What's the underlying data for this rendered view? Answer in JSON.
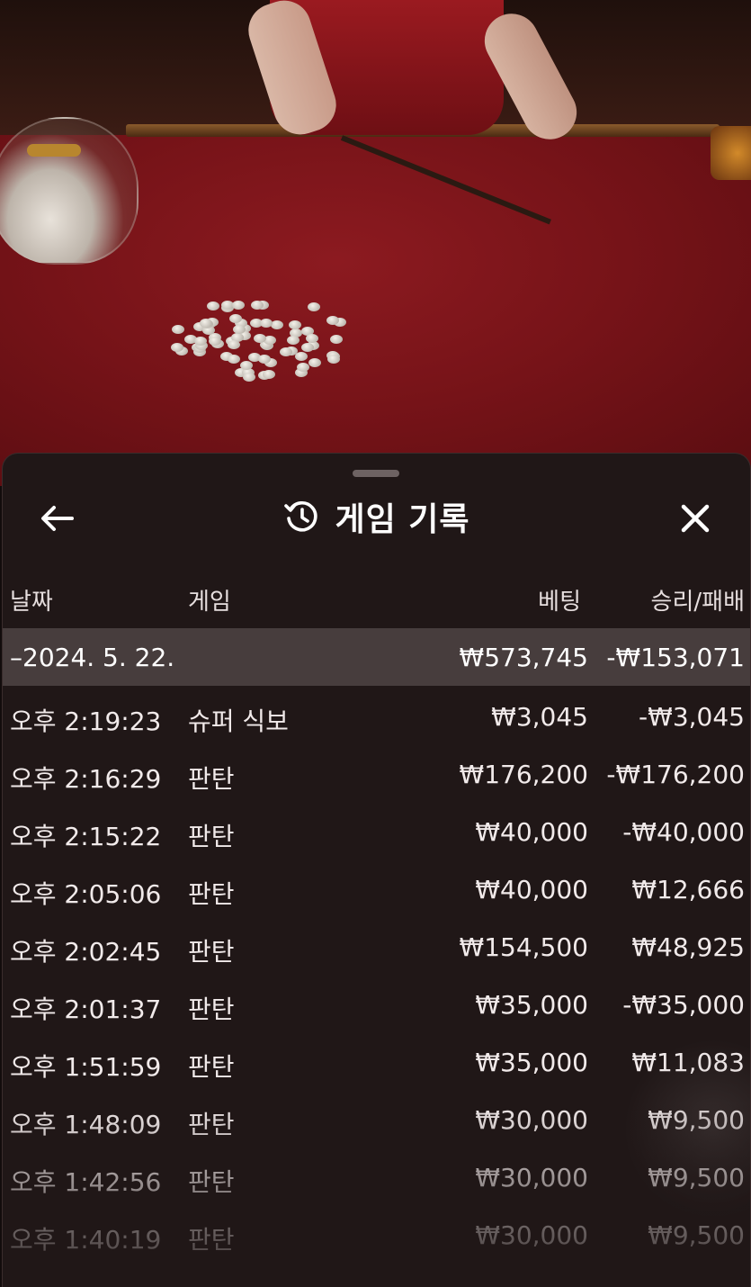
{
  "header": {
    "title": "게임 기록",
    "back_icon": "arrow-left-icon",
    "history_icon": "history-clock-icon",
    "close_icon": "close-x-icon"
  },
  "columns": {
    "date": "날짜",
    "game": "게임",
    "bet": "베팅",
    "win_loss": "승리/패배"
  },
  "date_group": {
    "date": "–2024. 5. 22.",
    "total_bet": "₩573,745",
    "total_result": "-₩153,071"
  },
  "rows": [
    {
      "time": "오후 2:19:23",
      "game": "슈퍼 식보",
      "bet": "₩3,045",
      "result": "-₩3,045"
    },
    {
      "time": "오후 2:16:29",
      "game": "판탄",
      "bet": "₩176,200",
      "result": "-₩176,200"
    },
    {
      "time": "오후 2:15:22",
      "game": "판탄",
      "bet": "₩40,000",
      "result": "-₩40,000"
    },
    {
      "time": "오후 2:05:06",
      "game": "판탄",
      "bet": "₩40,000",
      "result": "₩12,666"
    },
    {
      "time": "오후 2:02:45",
      "game": "판탄",
      "bet": "₩154,500",
      "result": "₩48,925"
    },
    {
      "time": "오후 2:01:37",
      "game": "판탄",
      "bet": "₩35,000",
      "result": "-₩35,000"
    },
    {
      "time": "오후 1:51:59",
      "game": "판탄",
      "bet": "₩35,000",
      "result": "₩11,083"
    },
    {
      "time": "오후 1:48:09",
      "game": "판탄",
      "bet": "₩30,000",
      "result": "₩9,500"
    },
    {
      "time": "오후 1:42:56",
      "game": "판탄",
      "bet": "₩30,000",
      "result": "₩9,500"
    },
    {
      "time": "오후 1:40:19",
      "game": "판탄",
      "bet": "₩30,000",
      "result": "₩9,500"
    }
  ]
}
